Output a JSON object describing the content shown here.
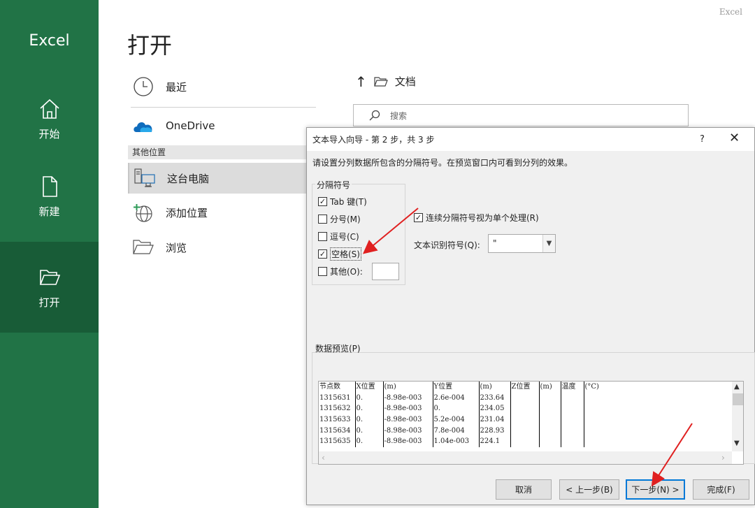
{
  "app": {
    "brand": "Excel",
    "corner_label": "Excel"
  },
  "nav": [
    {
      "label": "开始",
      "icon": "home-icon"
    },
    {
      "label": "新建",
      "icon": "new-file-icon"
    },
    {
      "label": "打开",
      "icon": "open-folder-icon",
      "active": true
    }
  ],
  "page": {
    "title": "打开"
  },
  "places": {
    "recent": "最近",
    "onedrive": "OneDrive",
    "other_header": "其他位置",
    "this_pc": "这台电脑",
    "add_place": "添加位置",
    "browse": "浏览"
  },
  "location": {
    "folder": "文档",
    "search_placeholder": "搜索"
  },
  "dialog": {
    "title": "文本导入向导 - 第 2 步，共 3 步",
    "help": "?",
    "close": "✕",
    "description": "请设置分列数据所包含的分隔符号。在预览窗口内可看到分列的效果。",
    "delimiters_legend": "分隔符号",
    "delimiters": [
      {
        "label": "Tab 键(T)",
        "checked": true
      },
      {
        "label": "分号(M)",
        "checked": false
      },
      {
        "label": "逗号(C)",
        "checked": false
      },
      {
        "label": "空格(S)",
        "checked": true
      },
      {
        "label": "其他(O):",
        "checked": false
      }
    ],
    "consecutive_label": "连续分隔符号视为单个处理(R)",
    "consecutive_checked": true,
    "qualifier_label": "文本识别符号(Q):",
    "qualifier_value": "\"",
    "preview_legend": "数据预览(P)",
    "preview_rows": [
      [
        "节点数",
        "X位置",
        "(m)",
        "Y位置",
        "(m)",
        "Z位置",
        "(m)",
        "温度",
        "(°C)"
      ],
      [
        "1315631",
        "0.",
        "-8.98e-003",
        "2.6e-004",
        "233.64",
        "",
        "",
        "",
        ""
      ],
      [
        "1315632",
        "0.",
        "-8.98e-003",
        "0.",
        "234.05",
        "",
        "",
        "",
        ""
      ],
      [
        "1315633",
        "0.",
        "-8.98e-003",
        "5.2e-004",
        "231.04",
        "",
        "",
        "",
        ""
      ],
      [
        "1315634",
        "0.",
        "-8.98e-003",
        "7.8e-004",
        "228.93",
        "",
        "",
        "",
        ""
      ],
      [
        "1315635",
        "0.",
        "-8.98e-003",
        "1.04e-003",
        "224.1",
        "",
        "",
        "",
        ""
      ]
    ],
    "buttons": {
      "cancel": "取消",
      "back": "< 上一步(B)",
      "next": "下一步(N) >",
      "finish": "完成(F)"
    }
  },
  "colors": {
    "excel_green": "#217346",
    "excel_green_active": "#185c37",
    "annotation_red": "#e02020"
  }
}
